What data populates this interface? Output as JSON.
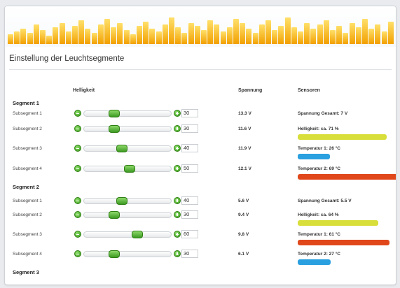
{
  "colors": {
    "banner_bar": "#f6b000",
    "slider_green": "#4caf2a",
    "bar_yellow": "#d8de3a",
    "bar_blue": "#2aa0e0",
    "bar_red": "#e0481c"
  },
  "page": {
    "title": "Einstellung der Leuchtsegmente"
  },
  "table": {
    "col_brightness": "Helligkeit",
    "col_voltage": "Spannung",
    "col_sensors": "Sensoren"
  },
  "segments": [
    {
      "label": "Segment 1",
      "subsegments": [
        {
          "label": "Subsegment 1",
          "value": "30",
          "level": 0.3,
          "voltage": "13.3 V",
          "sensor": "Spannung Gesamt: 7 V",
          "bar": null
        },
        {
          "label": "Subsegment 2",
          "value": "30",
          "level": 0.3,
          "voltage": "11.6 V",
          "sensor": "Helligkeit: ca. 71 %",
          "bar": "yellow",
          "bar_fill": 0.71
        },
        {
          "label": "Subsegment 3",
          "value": "40",
          "level": 0.4,
          "voltage": "11.9 V",
          "sensor": "Temperatur 1: 26 °C",
          "bar": "blue",
          "bar_fill": 0.26
        },
        {
          "label": "Subsegment 4",
          "value": "50",
          "level": 0.5,
          "voltage": "12.1 V",
          "sensor": "Temperatur 2: 69 °C",
          "bar": "red",
          "bar_fill": 0.69
        }
      ]
    },
    {
      "label": "Segment 2",
      "subsegments": [
        {
          "label": "Subsegment 1",
          "value": "40",
          "level": 0.4,
          "voltage": "5.6 V",
          "sensor": "Spannung Gesamt: 5.5 V",
          "bar": null
        },
        {
          "label": "Subsegment 2",
          "value": "30",
          "level": 0.3,
          "voltage": "9.4 V",
          "sensor": "Helligkeit: ca. 64 %",
          "bar": "yellow",
          "bar_fill": 0.64
        },
        {
          "label": "Subsegment 3",
          "value": "60",
          "level": 0.6,
          "voltage": "9.8 V",
          "sensor": "Temperatur 1: 61 °C",
          "bar": "red",
          "bar_fill": 0.61
        },
        {
          "label": "Subsegment 4",
          "value": "30",
          "level": 0.3,
          "voltage": "6.1 V",
          "sensor": "Temperatur 2: 27 °C",
          "bar": "blue",
          "bar_fill": 0.27
        }
      ]
    },
    {
      "label": "Segment 3",
      "subsegments": []
    }
  ]
}
